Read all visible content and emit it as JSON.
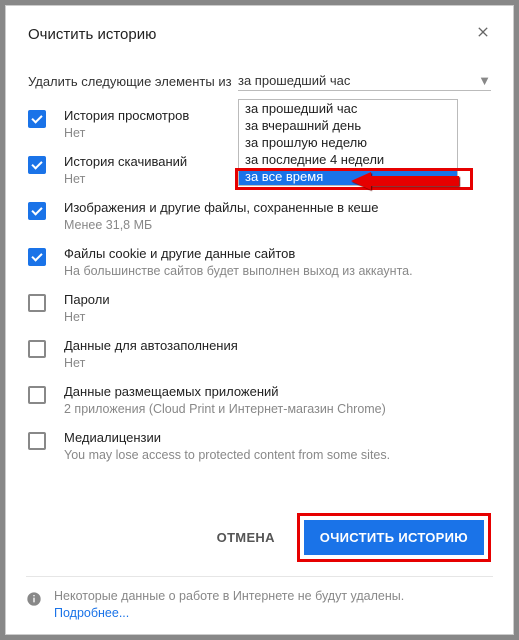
{
  "dialog": {
    "title": "Очистить историю",
    "range_label": "Удалить следующие элементы из",
    "range_selected": "за прошедший час"
  },
  "dropdown": {
    "options": [
      "за прошедший час",
      "за вчерашний день",
      "за прошлую неделю",
      "за последние 4 недели",
      "за все время"
    ],
    "highlighted_index": 4
  },
  "items": [
    {
      "checked": true,
      "title": "История просмотров",
      "sub": "Нет"
    },
    {
      "checked": true,
      "title": "История скачиваний",
      "sub": "Нет"
    },
    {
      "checked": true,
      "title": "Изображения и другие файлы, сохраненные в кеше",
      "sub": "Менее 31,8 МБ"
    },
    {
      "checked": true,
      "title": "Файлы cookie и другие данные сайтов",
      "sub": "На большинстве сайтов будет выполнен выход из аккаунта."
    },
    {
      "checked": false,
      "title": "Пароли",
      "sub": "Нет"
    },
    {
      "checked": false,
      "title": "Данные для автозаполнения",
      "sub": "Нет"
    },
    {
      "checked": false,
      "title": "Данные размещаемых приложений",
      "sub": "2 приложения (Cloud Print и Интернет-магазин Chrome)"
    },
    {
      "checked": false,
      "title": "Медиалицензии",
      "sub": "You may lose access to protected content from some sites."
    }
  ],
  "buttons": {
    "cancel": "ОТМЕНА",
    "clear": "ОЧИСТИТЬ ИСТОРИЮ"
  },
  "footer": {
    "text": "Некоторые данные о работе в Интернете не будут удалены.",
    "link": "Подробнее..."
  }
}
